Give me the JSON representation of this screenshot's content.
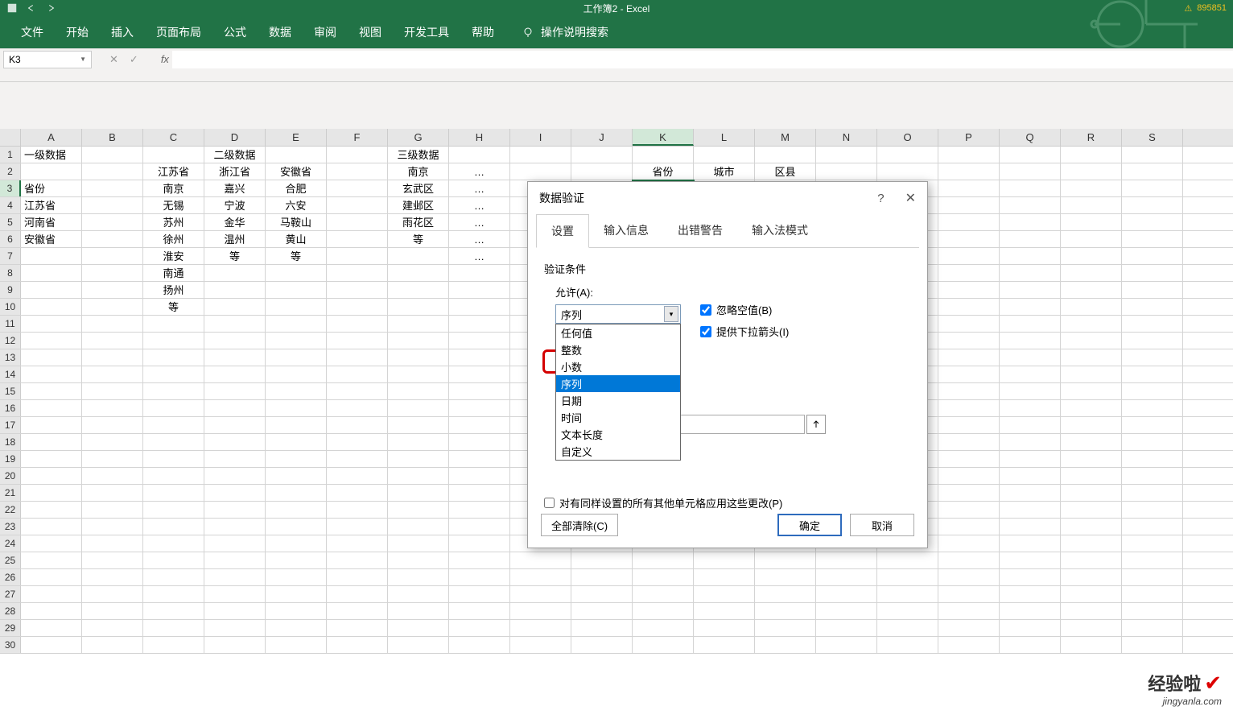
{
  "titlebar": {
    "center": "工作簿2 - Excel",
    "warn": "",
    "id": "895851"
  },
  "ribbon": {
    "tabs": [
      "文件",
      "开始",
      "插入",
      "页面布局",
      "公式",
      "数据",
      "审阅",
      "视图",
      "开发工具",
      "帮助"
    ],
    "tell": "操作说明搜索"
  },
  "namebox": "K3",
  "columns": [
    "A",
    "B",
    "C",
    "D",
    "E",
    "F",
    "G",
    "H",
    "I",
    "J",
    "K",
    "L",
    "M",
    "N",
    "O",
    "P",
    "Q",
    "R",
    "S"
  ],
  "rownums": [
    "1",
    "2",
    "3",
    "4",
    "5",
    "6",
    "7",
    "8",
    "9",
    "10",
    "11",
    "12",
    "13",
    "14",
    "15",
    "16",
    "17",
    "18",
    "19",
    "20",
    "21",
    "22",
    "23",
    "24",
    "25",
    "26",
    "27",
    "28",
    "29",
    "30"
  ],
  "cells": {
    "r1": {
      "A": "一级数据",
      "D": "二级数据",
      "G": "三级数据"
    },
    "r2": {
      "C": "江苏省",
      "D": "浙江省",
      "E": "安徽省",
      "G": "南京",
      "H": "…",
      "K": "省份",
      "L": "城市",
      "M": "区县"
    },
    "r3": {
      "A": "省份",
      "C": "南京",
      "D": "嘉兴",
      "E": "合肥",
      "G": "玄武区",
      "H": "…"
    },
    "r4": {
      "A": "江苏省",
      "C": "无锡",
      "D": "宁波",
      "E": "六安",
      "G": "建邺区",
      "H": "…"
    },
    "r5": {
      "A": "河南省",
      "C": "苏州",
      "D": "金华",
      "E": "马鞍山",
      "G": "雨花区",
      "H": "…"
    },
    "r6": {
      "A": "安徽省",
      "C": "徐州",
      "D": "温州",
      "E": "黄山",
      "G": "等",
      "H": "…"
    },
    "r7": {
      "C": "淮安",
      "D": "等",
      "E": "等",
      "H": "…"
    },
    "r8": {
      "C": "南通"
    },
    "r9": {
      "C": "扬州"
    },
    "r10": {
      "C": "等"
    }
  },
  "dialog": {
    "title": "数据验证",
    "tabs": [
      "设置",
      "输入信息",
      "出错警告",
      "输入法模式"
    ],
    "cond_label": "验证条件",
    "allow_label": "允许(A):",
    "allow_value": "序列",
    "options": [
      "任何值",
      "整数",
      "小数",
      "序列",
      "日期",
      "时间",
      "文本长度",
      "自定义"
    ],
    "ignore_blank": "忽略空值(B)",
    "dropdown_arrow": "提供下拉箭头(I)",
    "apply_all": "对有同样设置的所有其他单元格应用这些更改(P)",
    "clear": "全部清除(C)",
    "ok": "确定",
    "cancel": "取消"
  },
  "watermark": {
    "brand": "经验啦",
    "url": "jingyanla.com"
  }
}
